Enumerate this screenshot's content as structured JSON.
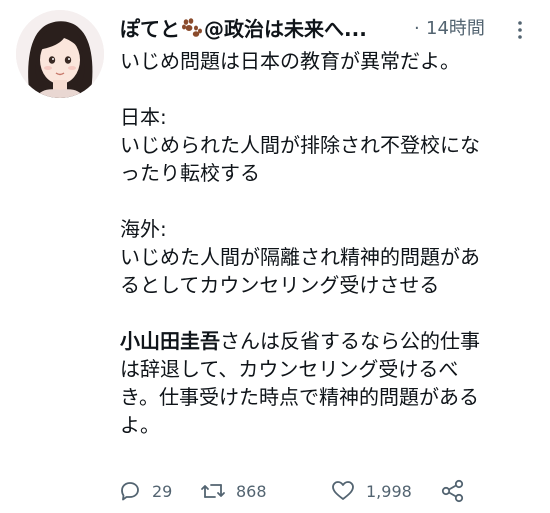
{
  "tweet": {
    "display_name_before_emoji": "ぽてと",
    "display_name_after_emoji": "@政治は未来へ...",
    "time_separator": "·",
    "time": "14時間",
    "paragraphs": [
      "いじめ問題は日本の教育が異常だよ。",
      "日本:\nいじめられた人間が排除され不登校にな\nったり転校する",
      "海外:\nいじめた人間が隔離され精神的問題があ\nるとしてカウンセリング受けさせる"
    ],
    "last_paragraph_bold": "小山田圭吾",
    "last_paragraph_rest": "さんは反省するなら公的仕事\nは辞退して、カウンセリング受けるべ\nき。仕事受けた時点で精神的問題がある\nよ。"
  },
  "actions": {
    "reply_count": "29",
    "retweet_count": "868",
    "like_count": "1,998"
  },
  "icons": {
    "emoji": "paw-prints-icon",
    "more": "more-vertical-icon",
    "reply": "reply-icon",
    "retweet": "retweet-icon",
    "like": "heart-icon",
    "share": "share-icon"
  },
  "colors": {
    "text": "#0f1419",
    "secondary": "#536471",
    "paw": "#8a4b2c"
  }
}
